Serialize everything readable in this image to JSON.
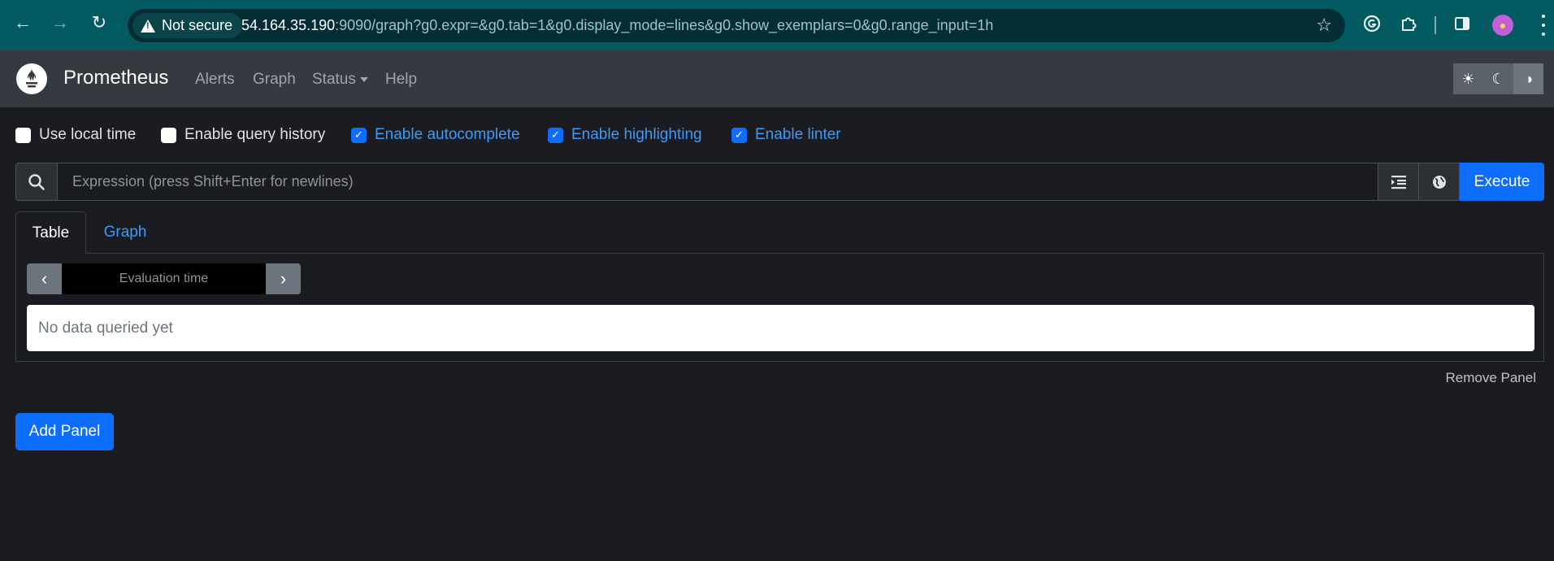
{
  "browser": {
    "security_label": "Not secure",
    "url_host": "54.164.35.190",
    "url_rest": ":9090/graph?g0.expr=&g0.tab=1&g0.display_mode=lines&g0.show_exemplars=0&g0.range_input=1h"
  },
  "navbar": {
    "brand": "Prometheus",
    "links": [
      "Alerts",
      "Graph",
      "Status",
      "Help"
    ]
  },
  "options": [
    {
      "label": "Use local time",
      "checked": false
    },
    {
      "label": "Enable query history",
      "checked": false
    },
    {
      "label": "Enable autocomplete",
      "checked": true
    },
    {
      "label": "Enable highlighting",
      "checked": true
    },
    {
      "label": "Enable linter",
      "checked": true
    }
  ],
  "expression": {
    "placeholder": "Expression (press Shift+Enter for newlines)",
    "execute_label": "Execute"
  },
  "panel": {
    "tabs": [
      "Table",
      "Graph"
    ],
    "eval_placeholder": "Evaluation time",
    "empty_message": "No data queried yet",
    "remove_label": "Remove Panel"
  },
  "add_panel_label": "Add Panel",
  "colors": {
    "accent": "#0d6efd",
    "link": "#3d9bf8",
    "background": "#1b1c21",
    "navbar": "#343a40",
    "chrome": "#035a61"
  }
}
